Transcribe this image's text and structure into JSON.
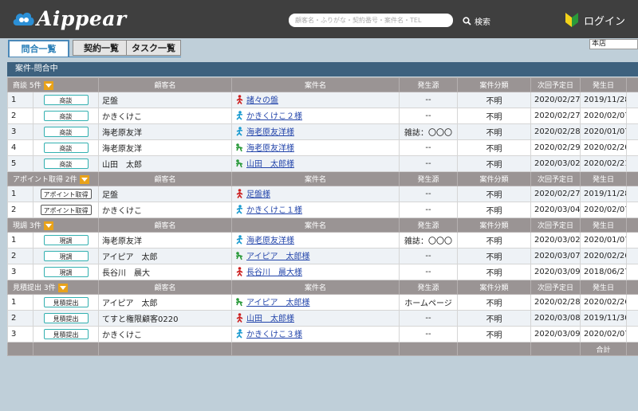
{
  "header": {
    "logo_text": "Aippear",
    "search": {
      "placeholder": "顧客名・ふりがな・契約番号・案件名・TEL"
    },
    "search_button": "検索",
    "login": "ログイン"
  },
  "tabs": [
    {
      "label": "問合一覧"
    },
    {
      "label": "契約一覧"
    },
    {
      "label": "タスク一覧"
    }
  ],
  "store_select": {
    "value": "本店"
  },
  "panel_title": "案件-問合中",
  "columns": [
    "顧客名",
    "案件名",
    "発生源",
    "案件分類",
    "次回予定日",
    "発生日"
  ],
  "groups": [
    {
      "label": "商談 5件",
      "rows": [
        {
          "no": "1",
          "status": "商談",
          "customer": "足盤",
          "case_icon": "red",
          "case": "諸々の盤",
          "source": "--",
          "category": "不明",
          "next": "2020/02/27",
          "date": "2019/11/28"
        },
        {
          "no": "2",
          "status": "商談",
          "customer": "かきくけこ",
          "case_icon": "teal",
          "case": "かきくけこ２様",
          "source": "--",
          "category": "不明",
          "next": "2020/02/27",
          "date": "2020/02/07"
        },
        {
          "no": "3",
          "status": "商談",
          "customer": "海老原友洋",
          "case_icon": "teal",
          "case": "海老原友洋様",
          "source": "雑誌：〇〇〇",
          "category": "不明",
          "next": "2020/02/28",
          "date": "2020/01/07"
        },
        {
          "no": "4",
          "status": "商談",
          "customer": "海老原友洋",
          "case_icon": "green",
          "case": "海老原友洋様",
          "source": "--",
          "category": "不明",
          "next": "2020/02/29",
          "date": "2020/02/20"
        },
        {
          "no": "5",
          "status": "商談",
          "customer": "山田　太郎",
          "case_icon": "green",
          "case": "山田　太郎様",
          "source": "--",
          "category": "不明",
          "next": "2020/03/02",
          "date": "2020/02/21"
        }
      ]
    },
    {
      "label": "アポイント取得 2件",
      "rows": [
        {
          "no": "1",
          "status": "アポイント取得",
          "customer": "足盤",
          "case_icon": "red",
          "case": "足盤様",
          "source": "--",
          "category": "不明",
          "next": "2020/02/27",
          "date": "2019/11/28"
        },
        {
          "no": "2",
          "status": "アポイント取得",
          "customer": "かきくけこ",
          "case_icon": "teal",
          "case": "かきくけこ１様",
          "source": "--",
          "category": "不明",
          "next": "2020/03/04",
          "date": "2020/02/07"
        }
      ]
    },
    {
      "label": "現調 3件",
      "rows": [
        {
          "no": "1",
          "status": "現調",
          "customer": "海老原友洋",
          "case_icon": "teal",
          "case": "海老原友洋様",
          "source": "雑誌：〇〇〇",
          "category": "不明",
          "next": "2020/03/02",
          "date": "2020/01/07"
        },
        {
          "no": "2",
          "status": "現調",
          "customer": "アイピア　太郎",
          "case_icon": "green",
          "case": "アイピア　太郎様",
          "source": "--",
          "category": "不明",
          "next": "2020/03/07",
          "date": "2020/02/26"
        },
        {
          "no": "3",
          "status": "現調",
          "customer": "長谷川　晨大",
          "case_icon": "red",
          "case": "長谷川　晨大様",
          "source": "--",
          "category": "不明",
          "next": "2020/03/09",
          "date": "2018/06/27"
        }
      ]
    },
    {
      "label": "見積提出 3件",
      "rows": [
        {
          "no": "1",
          "status": "見積提出",
          "customer": "アイピア　太郎",
          "case_icon": "green",
          "case": "アイピア　太郎様",
          "source": "ホームページ",
          "category": "不明",
          "next": "2020/02/28",
          "date": "2020/02/26"
        },
        {
          "no": "2",
          "status": "見積提出",
          "customer": "てすと権限顧客0220",
          "case_icon": "red",
          "case": "山田　太郎様",
          "source": "--",
          "category": "不明",
          "next": "2020/03/08",
          "date": "2019/11/30"
        },
        {
          "no": "3",
          "status": "見積提出",
          "customer": "かきくけこ",
          "case_icon": "teal",
          "case": "かきくけこ３様",
          "source": "--",
          "category": "不明",
          "next": "2020/03/09",
          "date": "2020/02/07"
        }
      ]
    }
  ],
  "footer": {
    "total_label": "合計"
  },
  "colors": {
    "header_bg": "#3f3f3f",
    "panel_title": "#3d617e",
    "group_header": "#9a9494",
    "toggle": "#e8a21a",
    "badge_border": "#32b0b0",
    "link": "#2244aa",
    "person_red": "#cc2222",
    "person_teal": "#1a9bd0",
    "person_green": "#2a9a3a"
  }
}
